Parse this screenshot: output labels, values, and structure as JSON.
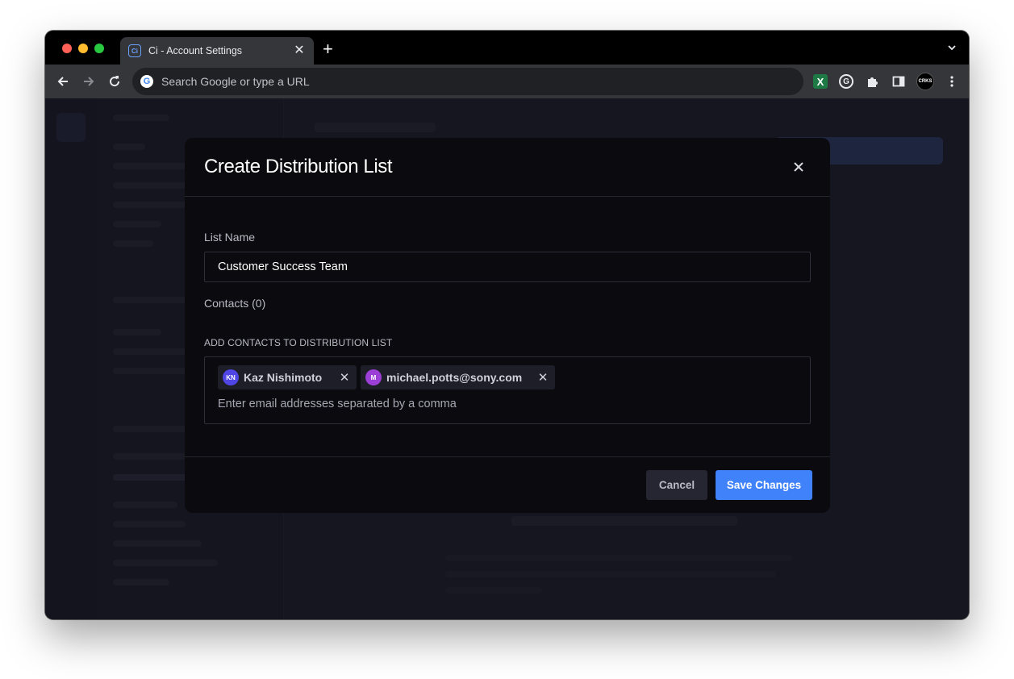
{
  "browser": {
    "tab_title": "Ci - Account Settings",
    "tab_favicon_text": "Ci",
    "omnibox_placeholder": "Search Google or type a URL",
    "google_logo_letter": "G",
    "extensions": [
      {
        "name": "excel-extension",
        "glyph": "X"
      },
      {
        "name": "grammarly-extension",
        "glyph": "G"
      },
      {
        "name": "puzzle-icon"
      },
      {
        "name": "side-panel-icon"
      },
      {
        "name": "profile-avatar",
        "glyph": "CRKS"
      },
      {
        "name": "kebab-menu-icon"
      }
    ]
  },
  "modal": {
    "title": "Create Distribution List",
    "list_name_label": "List Name",
    "list_name_value": "Customer Success Team",
    "contacts_label": "Contacts (0)",
    "add_contacts_label": "ADD CONTACTS TO DISTRIBUTION LIST",
    "chips": [
      {
        "initials": "KN",
        "label": "Kaz Nishimoto",
        "color": "#4f46e5"
      },
      {
        "initials": "M",
        "label": "michael.potts@sony.com",
        "color": "#9b3fd6"
      }
    ],
    "email_placeholder": "Enter email addresses separated by a comma",
    "cancel_label": "Cancel",
    "save_label": "Save Changes"
  },
  "colors": {
    "accent": "#3f82f9",
    "modal_bg": "#0b0b0f",
    "app_bg": "#1e1e28"
  }
}
